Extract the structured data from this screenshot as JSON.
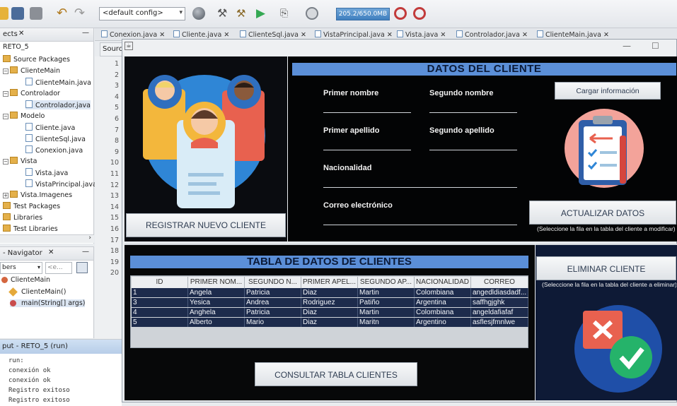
{
  "toolbar": {
    "config_value": "<default config>",
    "memory_label": "205.2/650.0MB"
  },
  "projects_panel": {
    "title": "ects",
    "items": [
      {
        "label": "RETO_5"
      },
      {
        "label": "Source Packages"
      },
      {
        "label": "ClienteMain"
      },
      {
        "label": "ClienteMain.java"
      },
      {
        "label": "Controlador"
      },
      {
        "label": "Controlador.java"
      },
      {
        "label": "Modelo"
      },
      {
        "label": "Cliente.java"
      },
      {
        "label": "ClienteSql.java"
      },
      {
        "label": "Conexion.java"
      },
      {
        "label": "Vista"
      },
      {
        "label": "Vista.java"
      },
      {
        "label": "VistaPrincipal.java"
      },
      {
        "label": "Vista.Imagenes"
      },
      {
        "label": "Test Packages"
      },
      {
        "label": "Libraries"
      },
      {
        "label": "Test Libraries"
      }
    ]
  },
  "navigator": {
    "title": "- Navigator",
    "filter_label": "bers",
    "filter_input": "<e...",
    "items": [
      {
        "label": "ClienteMain"
      },
      {
        "label": "ClienteMain()"
      },
      {
        "label": "main(String[] args)"
      }
    ]
  },
  "output": {
    "title": "put - RETO_5 (run)",
    "lines": [
      "run:",
      "conexión ok",
      "conexión ok",
      "Registro exitoso",
      "Registro exitoso"
    ]
  },
  "editor": {
    "tabs": [
      "Conexion.java",
      "Cliente.java",
      "ClienteSql.java",
      "VistaPrincipal.java",
      "Vista.java",
      "Controlador.java",
      "ClienteMain.java"
    ],
    "source_tab": "Source",
    "line_numbers": [
      "1",
      "2",
      "3",
      "4",
      "5",
      "6",
      "7",
      "8",
      "9",
      "10",
      "11",
      "12",
      "13",
      "14",
      "15",
      "16",
      "17",
      "18",
      "19",
      "20"
    ]
  },
  "app": {
    "register_button": "REGISTRAR NUEVO CLIENTE",
    "form_title": "DATOS DEL CLIENTE",
    "labels": {
      "first_name": "Primer nombre",
      "second_name": "Segundo nombre",
      "first_surname": "Primer apellido",
      "second_surname": "Segundo apellido",
      "nationality": "Nacionalidad",
      "email": "Correo electrónico"
    },
    "load_button": "Cargar información",
    "update_button": "ACTUALIZAR DATOS",
    "update_hint": "(Seleccione la fila en la tabla del cliente a modificar)",
    "table_title": "TABLA DE DATOS DE CLIENTES",
    "columns": [
      "ID",
      "PRIMER NOM...",
      "SEGUNDO N...",
      "PRIMER APEL...",
      "SEGUNDO AP...",
      "NACIONALIDAD",
      "CORREO"
    ],
    "rows": [
      [
        "1",
        "Angela",
        "Patricia",
        "Diaz",
        "Martin",
        "Colombiana",
        "angedldiasdadf..."
      ],
      [
        "3",
        "Yesica",
        "Andrea",
        "Rodriguez",
        "Patiño",
        "Argentina",
        "saffhgjghk"
      ],
      [
        "4",
        "Anghela",
        "Patricia",
        "Diaz",
        "Martin",
        "Colombiana",
        "angeldafiafaf"
      ],
      [
        "5",
        "Alberto",
        "Mario",
        "Diaz",
        "Maritn",
        "Argentino",
        "asflesjfmnlwe"
      ]
    ],
    "query_button": "CONSULTAR TABLA CLIENTES",
    "delete_button": "ELIMINAR CLIENTE",
    "delete_hint": "(Seleccione la fila en la tabla del cliente a eliminar)"
  },
  "colors": {
    "header_blue": "#5b8fd8",
    "row_navy": "#1d2b4c",
    "circle_blue": "#2f86d6",
    "delete_panel": "#0e1a36"
  }
}
